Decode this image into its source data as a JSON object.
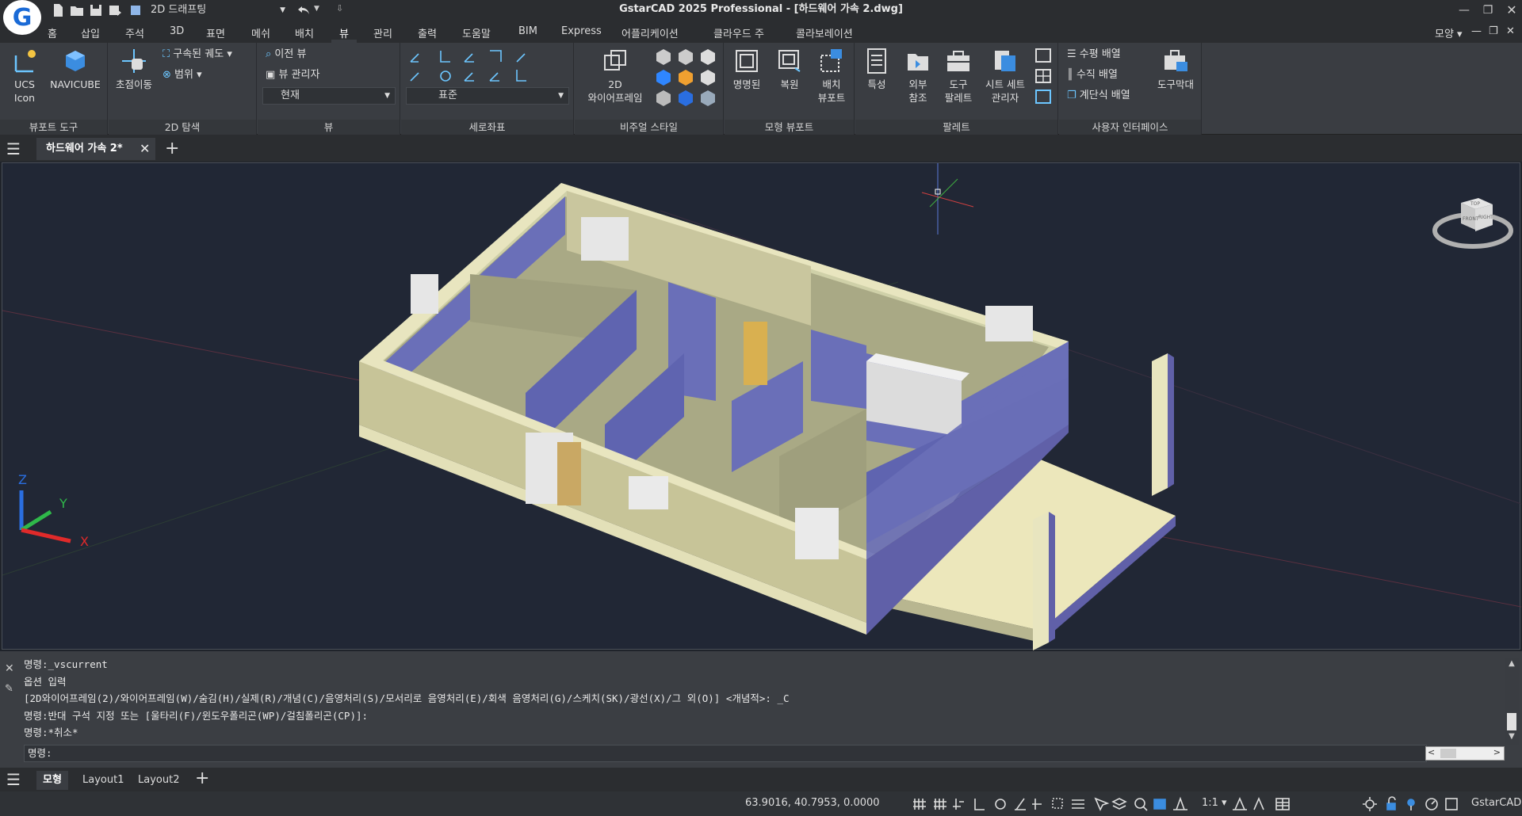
{
  "app": {
    "title": "GstarCAD 2025 Professional - [하드웨어 가속 2.dwg]",
    "workspace": "2D 드래프팅",
    "logo_letter": "G"
  },
  "menu": [
    "홈",
    "삽입",
    "주석",
    "3D",
    "표면",
    "메쉬",
    "배치",
    "뷰",
    "관리",
    "출력",
    "도움말",
    "BIM",
    "Express",
    "어플리케이션",
    "클라우드 주",
    "콜라보레이션"
  ],
  "menu_active": "뷰",
  "menu_right": "모양",
  "ribbon": {
    "panels": {
      "viewport_tools": "뷰포트 도구",
      "nav2d": "2D 탐색",
      "view": "뷰",
      "coords": "세로좌표",
      "visual_styles": "비주얼 스타일",
      "model_viewports": "모형 뷰포트",
      "palettes": "팔레트",
      "ui": "사용자 인터페이스"
    },
    "buttons": {
      "ucs_icon_1": "UCS",
      "ucs_icon_2": "Icon",
      "navicube": "NAVICUBE",
      "pan": "초점이동",
      "constrained_orbit": "구속된 궤도",
      "extents": "범위",
      "prev_view": "이전 뷰",
      "view_manager": "뷰 관리자",
      "current_view": "현재",
      "standard": "표준",
      "wireframe_1": "2D",
      "wireframe_2": "와이어프레임",
      "named": "명명된",
      "restore": "복원",
      "layout_vp_1": "배치",
      "layout_vp_2": "뷰포트",
      "properties": "특성",
      "xref_1": "외부",
      "xref_2": "참조",
      "tool_palette_1": "도구",
      "tool_palette_2": "팔레트",
      "sheetset_1": "시트 세트",
      "sheetset_2": "관리자",
      "tile_h": "수평 배열",
      "tile_v": "수직 배열",
      "cascade": "계단식 배열",
      "toolbars": "도구막대"
    }
  },
  "doc_tab": "하드웨어 가속 2*",
  "navcube": {
    "top": "TOP",
    "front": "FRONT",
    "right": "RIGHT"
  },
  "axes": {
    "x": "X",
    "y": "Y",
    "z": "Z"
  },
  "command": {
    "lines": [
      "명령:_vscurrent",
      "옵션 입력",
      "[2D와이어프레임(2)/와이어프레임(W)/숨김(H)/실제(R)/개념(C)/음영처리(S)/모서리로 음영처리(E)/회색 음영처리(G)/스케치(SK)/광선(X)/그 외(O)] <개념적>: _C",
      "명령:반대 구석 지정 또는 [울타리(F)/윈도우폴리곤(WP)/걸침폴리곤(CP)]:",
      "명령:*취소*"
    ],
    "prompt": "명령:"
  },
  "layout_tabs": [
    "모형",
    "Layout1",
    "Layout2"
  ],
  "status": {
    "coords": "63.9016, 40.7953, 0.0000",
    "scale": "1:1",
    "brand": "GstarCAD"
  }
}
